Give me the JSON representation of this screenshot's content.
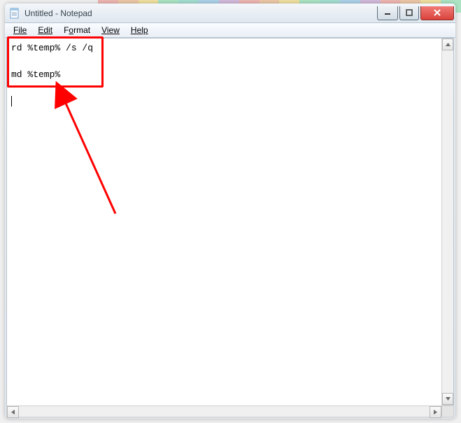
{
  "window": {
    "title": "Untitled - Notepad"
  },
  "menu": {
    "file": "File",
    "edit": "Edit",
    "format": "Format",
    "view": "View",
    "help": "Help"
  },
  "editor": {
    "line1": "rd %temp% /s /q",
    "line2": "md %temp%"
  }
}
